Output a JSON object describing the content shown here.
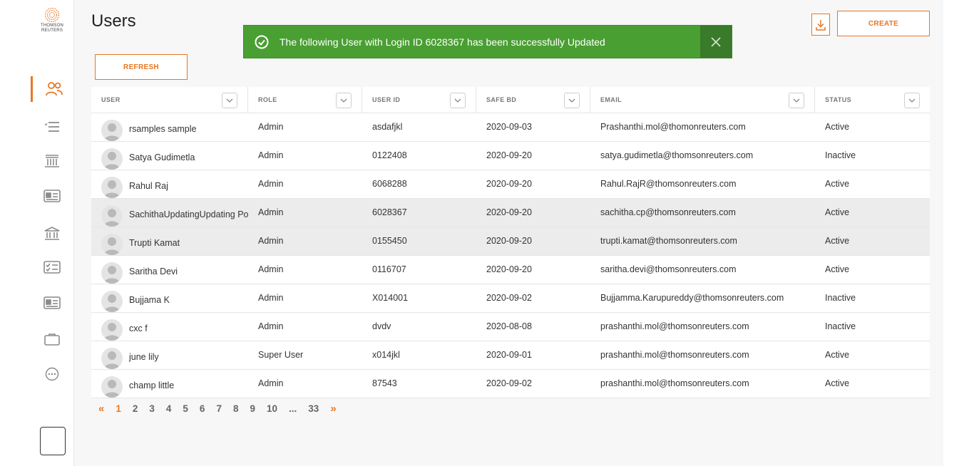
{
  "brand": {
    "line1": "THOMSON",
    "line2": "REUTERS",
    "accent": "#e87722"
  },
  "page": {
    "title": "Users"
  },
  "toolbar": {
    "refresh_label": "REFRESH",
    "create_label": "CREATE",
    "download_icon": "download-icon"
  },
  "toast": {
    "message": "The following User with Login ID 6028367 has been successfully Updated",
    "color": "#4a9f33",
    "icon": "check-circle-icon"
  },
  "sidebar": {
    "items": [
      {
        "icon": "users-icon",
        "active": true
      },
      {
        "icon": "list-icon",
        "active": false
      },
      {
        "icon": "bank-icon",
        "active": false
      },
      {
        "icon": "id-card-icon",
        "active": false
      },
      {
        "icon": "bank-building-icon",
        "active": false
      },
      {
        "icon": "checklist-icon",
        "active": false
      },
      {
        "icon": "id-card-alt-icon",
        "active": false
      },
      {
        "icon": "briefcase-icon",
        "active": false
      },
      {
        "icon": "more-icon",
        "active": false
      }
    ]
  },
  "table": {
    "columns": [
      "USER",
      "ROLE",
      "USER ID",
      "SAFE BD",
      "EMAIL",
      "STATUS"
    ],
    "rows": [
      {
        "user": "rsamples sample",
        "role": "Admin",
        "user_id": "asdafjkl",
        "safe_bd": "2020-09-03",
        "email": "Prashanthi.mol@thomonreuters.com",
        "status": "Active"
      },
      {
        "user": "Satya Gudimetla",
        "role": "Admin",
        "user_id": "0122408",
        "safe_bd": "2020-09-20",
        "email": "satya.gudimetla@thomsonreuters.com",
        "status": "Inactive"
      },
      {
        "user": "Rahul Raj",
        "role": "Admin",
        "user_id": "6068288",
        "safe_bd": "2020-09-20",
        "email": "Rahul.RajR@thomsonreuters.com",
        "status": "Active"
      },
      {
        "user": "SachithaUpdatingUpdating Po",
        "role": "Admin",
        "user_id": "6028367",
        "safe_bd": "2020-09-20",
        "email": "sachitha.cp@thomsonreuters.com",
        "status": "Active"
      },
      {
        "user": "Trupti Kamat",
        "role": "Admin",
        "user_id": "0155450",
        "safe_bd": "2020-09-20",
        "email": "trupti.kamat@thomsonreuters.com",
        "status": "Active"
      },
      {
        "user": "Saritha Devi",
        "role": "Admin",
        "user_id": "0116707",
        "safe_bd": "2020-09-20",
        "email": "saritha.devi@thomsonreuters.com",
        "status": "Active"
      },
      {
        "user": "Bujjama K",
        "role": "Admin",
        "user_id": "X014001",
        "safe_bd": "2020-09-02",
        "email": "Bujjamma.Karupureddy@thomsonreuters.com",
        "status": "Inactive"
      },
      {
        "user": "cxc f",
        "role": "Admin",
        "user_id": "dvdv",
        "safe_bd": "2020-08-08",
        "email": "prashanthi.mol@thomsonreuters.com",
        "status": "Inactive"
      },
      {
        "user": "june lily",
        "role": "Super User",
        "user_id": "x014jkl",
        "safe_bd": "2020-09-01",
        "email": "prashanthi.mol@thomsonreuters.com",
        "status": "Active"
      },
      {
        "user": "champ little",
        "role": "Admin",
        "user_id": "87543",
        "safe_bd": "2020-09-02",
        "email": "prashanthi.mol@thomsonreuters.com",
        "status": "Active"
      }
    ]
  },
  "pagination": {
    "prev": "«",
    "next": "»",
    "pages": [
      "1",
      "2",
      "3",
      "4",
      "5",
      "6",
      "7",
      "8",
      "9",
      "10",
      "...",
      "33"
    ],
    "current": "1"
  }
}
